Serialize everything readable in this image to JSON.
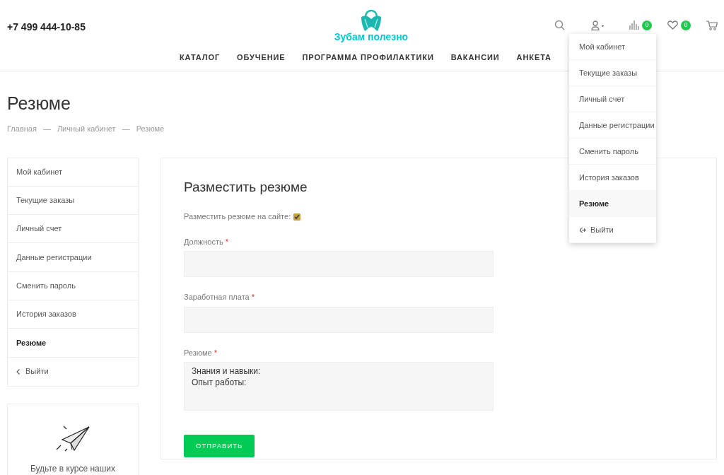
{
  "header": {
    "phone": "+7 499 444-10-85",
    "logo_text": "Зубам полезно",
    "icons": [
      {
        "kind": "search"
      },
      {
        "kind": "user"
      },
      {
        "kind": "compare",
        "count": "0"
      },
      {
        "kind": "favorites",
        "count": "0"
      },
      {
        "kind": "cart"
      }
    ],
    "nav": [
      "КАТАЛОГ",
      "ОБУЧЕНИЕ",
      "ПРОГРАММА ПРОФИЛАКТИКИ",
      "ВАКАНСИИ",
      "АНКЕТА"
    ]
  },
  "user_menu": {
    "expanded": true,
    "items": [
      {
        "label": "Мой кабинет",
        "selected": false,
        "kind": "link"
      },
      {
        "label": "Текущие заказы",
        "selected": false,
        "kind": "link"
      },
      {
        "label": "Личный счет",
        "selected": false,
        "kind": "link"
      },
      {
        "label": "Данные регистрации",
        "selected": false,
        "kind": "link"
      },
      {
        "label": "Сменить пароль",
        "selected": false,
        "kind": "link"
      },
      {
        "label": "История заказов",
        "selected": false,
        "kind": "link"
      },
      {
        "label": "Резюме",
        "selected": true,
        "kind": "link"
      },
      {
        "label": "Выйти",
        "selected": false,
        "kind": "logout"
      }
    ]
  },
  "page_title": "Резюме",
  "breadcrumbs": [
    "Главная",
    "Личный кабинет",
    "Резюме"
  ],
  "breadcrumb_separator": "—",
  "sidebar": {
    "items": [
      {
        "label": "Мой кабинет",
        "selected": false,
        "kind": "link"
      },
      {
        "label": "Текущие заказы",
        "selected": false,
        "kind": "link"
      },
      {
        "label": "Личный счет",
        "selected": false,
        "kind": "link"
      },
      {
        "label": "Данные регистрации",
        "selected": false,
        "kind": "link"
      },
      {
        "label": "Сменить пароль",
        "selected": false,
        "kind": "link"
      },
      {
        "label": "История заказов",
        "selected": false,
        "kind": "link"
      },
      {
        "label": "Резюме",
        "selected": true,
        "kind": "link"
      },
      {
        "label": "Выйти",
        "selected": false,
        "kind": "logout"
      }
    ],
    "promo": {
      "text": "Будьте в курсе наших"
    }
  },
  "form": {
    "title": "Разместить резюме",
    "publish": {
      "label": "Разместить резюме на сайте:",
      "checked": true
    },
    "fields": [
      {
        "label": "Должность",
        "required": true,
        "kind": "input"
      },
      {
        "label": "Заработная плата",
        "required": true,
        "kind": "input"
      },
      {
        "label": "Резюме",
        "required": true,
        "kind": "textarea",
        "value": "Знания и навыки:\nОпыт работы:"
      }
    ],
    "required_mark": "*",
    "submit": "ОТПРАВИТЬ"
  }
}
